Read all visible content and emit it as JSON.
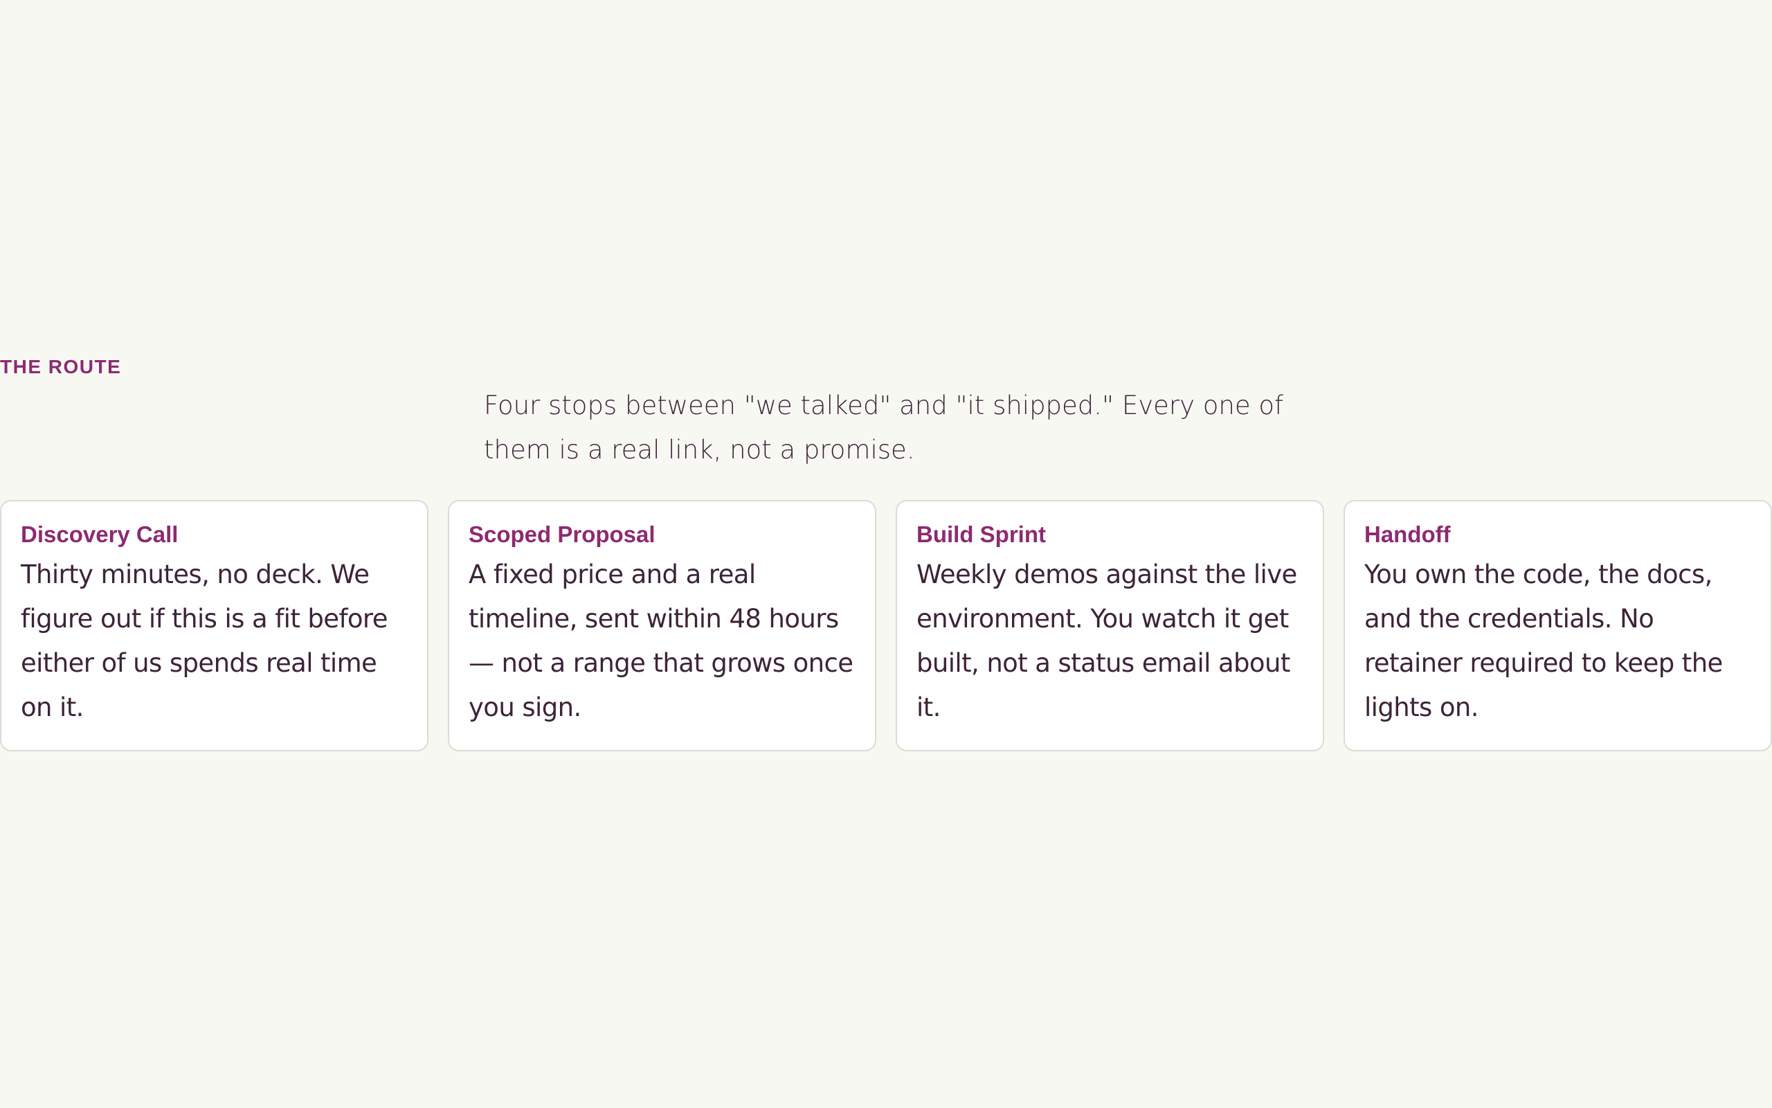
{
  "section": {
    "eyebrow": "THE ROUTE",
    "lede": "Four stops between \"we talked\" and \"it shipped.\" Every one of them is a real link, not a promise."
  },
  "steps": [
    {
      "title": "Discovery Call",
      "text": "Thirty minutes, no deck. We figure out if this is a fit before either of us spends real time on it."
    },
    {
      "title": "Scoped Proposal",
      "text": "A fixed price and a real timeline, sent within 48 hours — not a range that grows once you sign."
    },
    {
      "title": "Build Sprint",
      "text": "Weekly demos against the live environment. You watch it get built, not a status email about it."
    },
    {
      "title": "Handoff",
      "text": "You own the code, the docs, and the credentials. No retainer required to keep the lights on."
    }
  ],
  "colors": {
    "background": "#f8f8f3",
    "accent": "#8c2a72",
    "text": "#3d2438",
    "card_border": "#dcdcd4"
  }
}
